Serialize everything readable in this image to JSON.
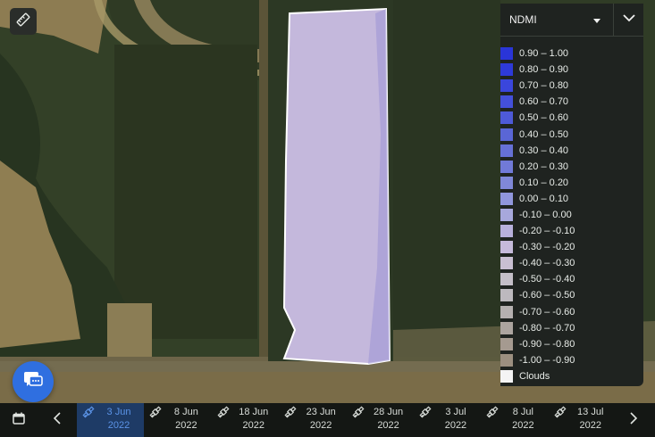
{
  "legend": {
    "index_name": "NDMI",
    "ranges": [
      {
        "label": "0.90 – 1.00",
        "color": "#2a35d8"
      },
      {
        "label": "0.80 – 0.90",
        "color": "#2e3ad9"
      },
      {
        "label": "0.70 – 0.80",
        "color": "#3a46dc"
      },
      {
        "label": "0.60 – 0.70",
        "color": "#4450da"
      },
      {
        "label": "0.50 – 0.60",
        "color": "#4e5ad8"
      },
      {
        "label": "0.40 – 0.50",
        "color": "#5a66d6"
      },
      {
        "label": "0.30 – 0.40",
        "color": "#6670d6"
      },
      {
        "label": "0.20 – 0.30",
        "color": "#717ad8"
      },
      {
        "label": "0.10 – 0.20",
        "color": "#8088d8"
      },
      {
        "label": "0.00 – 0.10",
        "color": "#9096dc"
      },
      {
        "label": "-0.10 – 0.00",
        "color": "#a7a8dc"
      },
      {
        "label": "-0.20 – -0.10",
        "color": "#b8b0dc"
      },
      {
        "label": "-0.30 – -0.20",
        "color": "#c6badb"
      },
      {
        "label": "-0.40 – -0.30",
        "color": "#c9bfd2"
      },
      {
        "label": "-0.50 – -0.40",
        "color": "#c4bec8"
      },
      {
        "label": "-0.60 – -0.50",
        "color": "#bdb9be"
      },
      {
        "label": "-0.70 – -0.60",
        "color": "#b5b0b0"
      },
      {
        "label": "-0.80 – -0.70",
        "color": "#aca49f"
      },
      {
        "label": "-0.90 – -0.80",
        "color": "#a59a90"
      },
      {
        "label": "-1.00 – -0.90",
        "color": "#9c8f80"
      },
      {
        "label": "Clouds",
        "color": "#f4f4f4"
      }
    ]
  },
  "timeline": {
    "dates": [
      {
        "line1": "3 Jun",
        "line2": "2022",
        "active": true
      },
      {
        "line1": "8 Jun",
        "line2": "2022",
        "active": false
      },
      {
        "line1": "18 Jun",
        "line2": "2022",
        "active": false
      },
      {
        "line1": "23 Jun",
        "line2": "2022",
        "active": false
      },
      {
        "line1": "28 Jun",
        "line2": "2022",
        "active": false
      },
      {
        "line1": "3 Jul",
        "line2": "2022",
        "active": false
      },
      {
        "line1": "8 Jul",
        "line2": "2022",
        "active": false
      },
      {
        "line1": "13 Jul",
        "line2": "2022",
        "active": false
      }
    ]
  },
  "icons": {
    "ruler": "ruler-icon",
    "dropdown": "caret-down-icon",
    "collapse": "chevron-down-icon",
    "chat": "chat-icon",
    "calendar": "calendar-icon",
    "prev": "chevron-left-icon",
    "next": "chevron-right-icon",
    "satellite": "satellite-icon"
  },
  "colors": {
    "field_fill": "#c4b8dc",
    "active_date": "#5b93e6",
    "chat_button": "#2f6fe0"
  }
}
